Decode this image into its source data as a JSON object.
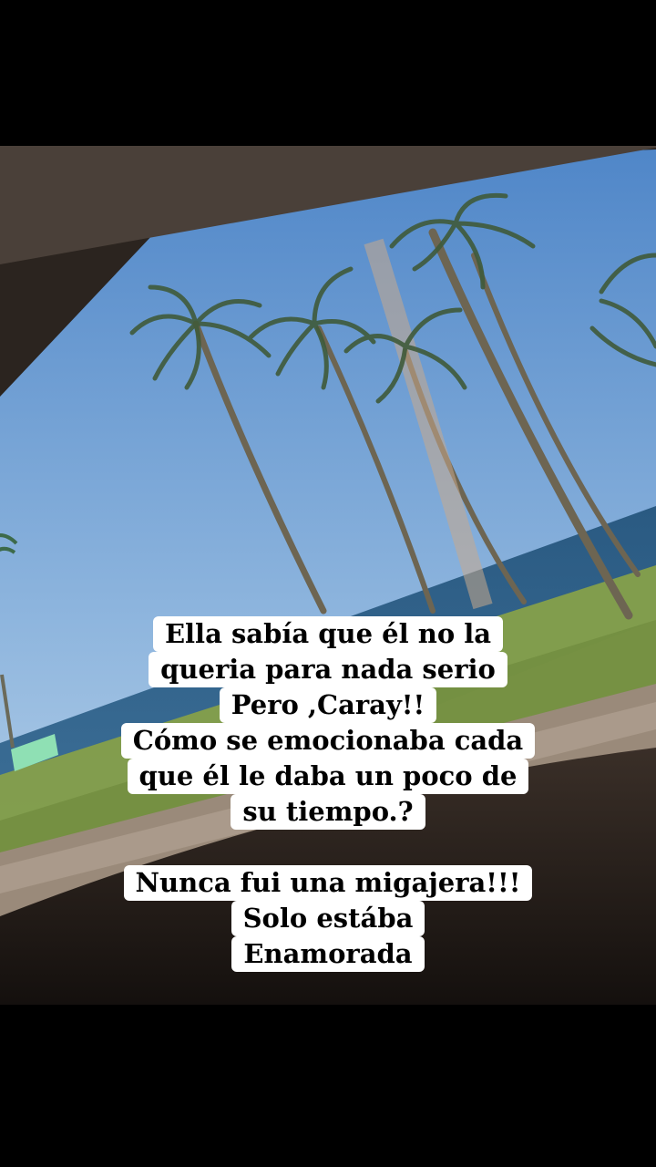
{
  "story": {
    "caption_lines": [
      "Ella sabía que él no la",
      "queria para nada serio",
      "Pero ,Caray!!",
      "Cómo se emocionaba cada",
      "que él le daba un poco de",
      "su tiempo.?",
      "Nunca fui una migajera!!!",
      "Solo estába",
      "Enamorada"
    ],
    "photo": {
      "subject": "palm-trees-by-the-sea-through-car-window",
      "colors": {
        "sky_top": "#4f86c8",
        "sky_bottom": "#b9d2e8",
        "sea": "#2f5f86",
        "grass": "#7f9a45",
        "car_interior": "#1a1512",
        "letterbox": "#000000"
      }
    }
  }
}
